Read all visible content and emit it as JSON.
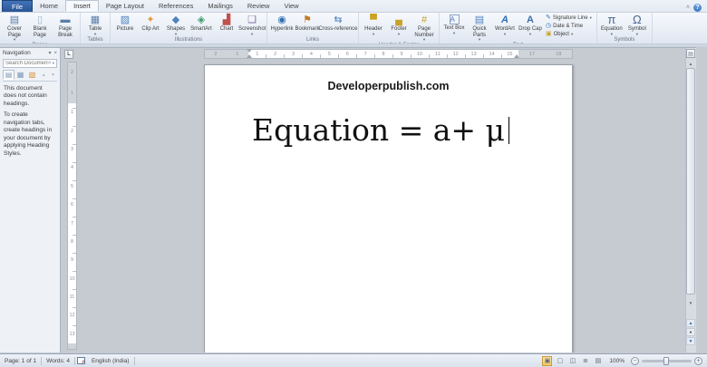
{
  "tabs": [
    {
      "label": "File"
    },
    {
      "label": "Home"
    },
    {
      "label": "Insert"
    },
    {
      "label": "Page Layout"
    },
    {
      "label": "References"
    },
    {
      "label": "Mailings"
    },
    {
      "label": "Review"
    },
    {
      "label": "View"
    }
  ],
  "window": {
    "help_label": "?",
    "minimize_ribbon_glyph": "˄"
  },
  "ribbon": {
    "groups": [
      {
        "label": "Pages",
        "buttons": [
          {
            "label": "Cover Page",
            "arrow": "▾",
            "glyph": "▤",
            "icon": "cover-page-icon"
          },
          {
            "label": "Blank Page",
            "arrow": "",
            "glyph": "▯",
            "icon": "blank-page-icon"
          },
          {
            "label": "Page Break",
            "arrow": "",
            "glyph": "▬",
            "icon": "page-break-icon"
          }
        ]
      },
      {
        "label": "Tables",
        "buttons": [
          {
            "label": "Table",
            "arrow": "▾",
            "glyph": "▦",
            "icon": "table-icon"
          }
        ]
      },
      {
        "label": "Illustrations",
        "buttons": [
          {
            "label": "Picture",
            "arrow": "",
            "glyph": "▨",
            "icon": "picture-icon"
          },
          {
            "label": "Clip Art",
            "arrow": "",
            "glyph": "✦",
            "icon": "clip-art-icon"
          },
          {
            "label": "Shapes",
            "arrow": "▾",
            "glyph": "◆",
            "icon": "shapes-icon"
          },
          {
            "label": "SmartArt",
            "arrow": "",
            "glyph": "◈",
            "icon": "smartart-icon"
          },
          {
            "label": "Chart",
            "arrow": "",
            "glyph": "▟",
            "icon": "chart-icon"
          },
          {
            "label": "Screenshot",
            "arrow": "▾",
            "glyph": "❑",
            "icon": "screenshot-icon"
          }
        ]
      },
      {
        "label": "Links",
        "buttons": [
          {
            "label": "Hyperlink",
            "arrow": "",
            "glyph": "◉",
            "icon": "hyperlink-icon"
          },
          {
            "label": "Bookmark",
            "arrow": "",
            "glyph": "⚑",
            "icon": "bookmark-icon"
          },
          {
            "label": "Cross-reference",
            "arrow": "",
            "glyph": "⇆",
            "icon": "cross-reference-icon"
          }
        ]
      },
      {
        "label": "Header & Footer",
        "buttons": [
          {
            "label": "Header",
            "arrow": "▾",
            "glyph": "▀",
            "icon": "header-icon"
          },
          {
            "label": "Footer",
            "arrow": "▾",
            "glyph": "▄",
            "icon": "footer-icon"
          },
          {
            "label": "Page Number",
            "arrow": "▾",
            "glyph": "#",
            "icon": "page-number-icon"
          }
        ]
      },
      {
        "label": "Text",
        "buttons": [
          {
            "label": "Text Box",
            "arrow": "▾",
            "glyph": "A",
            "icon": "text-box-icon"
          },
          {
            "label": "Quick Parts",
            "arrow": "▾",
            "glyph": "▤",
            "icon": "quick-parts-icon"
          },
          {
            "label": "WordArt",
            "arrow": "▾",
            "glyph": "A",
            "icon": "wordart-icon"
          },
          {
            "label": "Drop Cap",
            "arrow": "▾",
            "glyph": "A",
            "icon": "drop-cap-icon"
          }
        ],
        "small": [
          {
            "label": "Signature Line",
            "arrow": "▾",
            "glyph": "✎",
            "icon": "signature-line-icon"
          },
          {
            "label": "Date & Time",
            "arrow": "",
            "glyph": "◷",
            "icon": "date-time-icon"
          },
          {
            "label": "Object",
            "arrow": "▾",
            "glyph": "▣",
            "icon": "object-icon"
          }
        ]
      },
      {
        "label": "Symbols",
        "buttons": [
          {
            "label": "Equation",
            "arrow": "▾",
            "glyph": "π",
            "icon": "equation-icon"
          },
          {
            "label": "Symbol",
            "arrow": "▾",
            "glyph": "Ω",
            "icon": "symbol-icon"
          }
        ]
      }
    ]
  },
  "nav": {
    "title": "Navigation",
    "search_placeholder": "Search Document",
    "search_icon": "⌕",
    "dropdown_glyph": "▾",
    "close_glyph": "×",
    "tab_glyphs": [
      "▤",
      "▦",
      "▧"
    ],
    "arrows": "▲ ▼",
    "message_1": "This document does not contain headings.",
    "message_2": "To create navigation tabs, create headings in your document by applying Heading Styles."
  },
  "ruler_h": {
    "left": [
      "2",
      "1"
    ],
    "main": [
      "1",
      "2",
      "3",
      "4",
      "5",
      "6",
      "7",
      "8",
      "9",
      "10",
      "11",
      "12",
      "13",
      "14",
      "15"
    ],
    "right": [
      "17",
      "18"
    ]
  },
  "ruler_v": {
    "top": [
      "2",
      "1"
    ],
    "main": [
      "1",
      "2",
      "3",
      "4",
      "5",
      "6",
      "7",
      "8",
      "9",
      "10",
      "11",
      "12",
      "13"
    ]
  },
  "document": {
    "site_title": "Developerpublish.com",
    "equation": "Equation = a+ μ"
  },
  "scrollbar": {
    "ruler_toggle_glyph": "▤",
    "up": "▲",
    "down": "▼",
    "browse_prev": "▲",
    "browse_obj": "●",
    "browse_next": "▼"
  },
  "status": {
    "page": "Page: 1 of 1",
    "words": "Words: 4",
    "language": "English (India)",
    "zoom": "100%",
    "zoom_out": "−",
    "zoom_in": "+",
    "view_glyphs": [
      "▣",
      "▢",
      "◫",
      "≣",
      "▤"
    ]
  },
  "colors": {
    "file_tab_blue": "#2f5e9e",
    "status_active_highlight": "#f6c95f",
    "canvas_gray": "#c6cad1",
    "accent_blue": "#4f81bd"
  }
}
